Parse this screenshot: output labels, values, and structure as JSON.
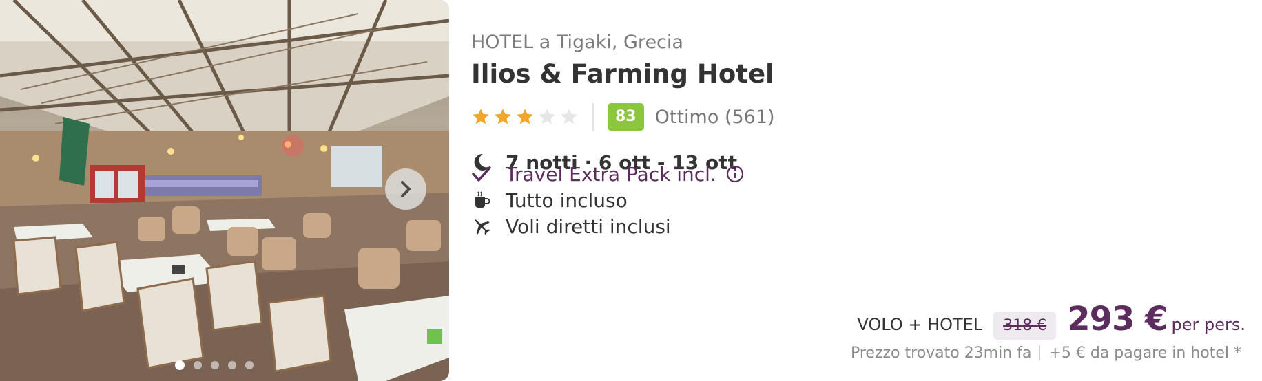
{
  "colors": {
    "brand_purple": "#5c2c5e",
    "star_filled": "#f4a62a",
    "star_empty": "#e6e6e6",
    "score_green": "#8cc63f"
  },
  "gallery": {
    "image_icon": "restaurant-photo",
    "next_icon": "chevron-right-icon",
    "photo_count": 5,
    "active_index": 0
  },
  "hotel": {
    "type_line": "HOTEL a Tigaki, Grecia",
    "name": "Ilios & Farming Hotel",
    "stars": 3,
    "stars_max": 5,
    "score": "83",
    "score_label": "Ottimo (561)"
  },
  "stay": {
    "icon": "moon-icon",
    "dates": "7 notti · 6 ott - 13 ott"
  },
  "features": {
    "extra_pack": {
      "icon": "check-icon",
      "label": "Travel Extra Pack incl.",
      "info_icon": "info-icon"
    },
    "board": {
      "icon": "cup-icon",
      "label": "Tutto incluso"
    },
    "flights": {
      "icon": "plane-icon",
      "label": "Voli diretti inclusi"
    }
  },
  "pricing": {
    "product_type": "VOLO + HOTEL",
    "old_price": "318 €",
    "price": "293 €",
    "per_person": "per pers.",
    "found": "Prezzo trovato 23min fa",
    "hotel_fee": "+5 € da pagare in hotel *"
  }
}
